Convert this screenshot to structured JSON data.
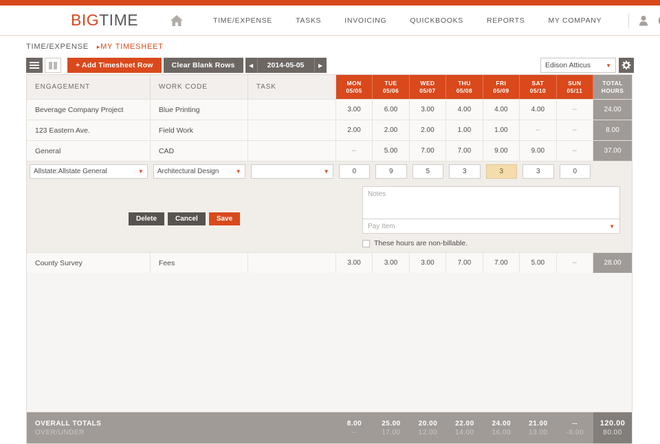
{
  "brand": {
    "name_first": "BIG",
    "name_second": "TIME",
    "accent": "#d9491c",
    "gray": "#6d6763"
  },
  "header": {
    "home_icon": "home-icon",
    "nav": [
      {
        "label": "TIME/EXPENSE"
      },
      {
        "label": "TASKS"
      },
      {
        "label": "INVOICING"
      },
      {
        "label": "QUICKBOOKS"
      },
      {
        "label": "REPORTS"
      },
      {
        "label": "MY COMPANY"
      }
    ],
    "user_icon": "user-icon",
    "help_icon": "help-icon"
  },
  "breadcrumb": {
    "parent": "TIME/EXPENSE",
    "caret": "▸",
    "current": "MY TIMESHEET"
  },
  "toolbar": {
    "view_list_icon": "list-view-icon",
    "view_grid_icon": "grid-view-icon",
    "add_row_label": "+  Add Timesheet Row",
    "clear_rows_label": "Clear Blank Rows",
    "prev_arrow": "◀",
    "next_arrow": "▶",
    "date_value": "2014-05-05",
    "user_name": "Edison Atticus",
    "dropdown_caret": "▼",
    "gear_icon": "gear-icon"
  },
  "grid": {
    "columns": {
      "engagement": "ENGAGEMENT",
      "work_code": "WORK CODE",
      "task": "TASK",
      "total_line1": "TOTAL",
      "total_line2": "HOURS"
    },
    "days": [
      {
        "name": "MON",
        "date": "05/05"
      },
      {
        "name": "TUE",
        "date": "05/06"
      },
      {
        "name": "WED",
        "date": "05/07"
      },
      {
        "name": "THU",
        "date": "05/08"
      },
      {
        "name": "FRI",
        "date": "05/09"
      },
      {
        "name": "SAT",
        "date": "05/10"
      },
      {
        "name": "SUN",
        "date": "05/11"
      }
    ],
    "rows": [
      {
        "engagement": "Beverage Company Project",
        "work_code": "Blue Printing",
        "task": "",
        "hours": [
          "3.00",
          "6.00",
          "3.00",
          "4.00",
          "4.00",
          "4.00",
          "--"
        ],
        "total": "24.00"
      },
      {
        "engagement": "123 Eastern Ave.",
        "work_code": "Field Work",
        "task": "",
        "hours": [
          "2.00",
          "2.00",
          "2.00",
          "1.00",
          "1.00",
          "--",
          "--"
        ],
        "total": "8.00"
      },
      {
        "engagement": "General",
        "work_code": "CAD",
        "task": "",
        "hours": [
          "--",
          "5.00",
          "7.00",
          "7.00",
          "9.00",
          "9.00",
          "--"
        ],
        "total": "37.00"
      }
    ],
    "row_after_edit": {
      "engagement": "County Survey",
      "work_code": "Fees",
      "task": "",
      "hours": [
        "3.00",
        "3.00",
        "3.00",
        "7.00",
        "7.00",
        "5.00",
        "--"
      ],
      "total": "28.00"
    }
  },
  "edit_row": {
    "engagement_value": "Allstate:Allstate General",
    "work_code_value": "Architectural Design",
    "task_value": "",
    "hours": [
      "0",
      "9",
      "5",
      "3",
      "3",
      "3",
      "0"
    ],
    "focused_index": 4,
    "notes_placeholder": "Notes",
    "pay_item_placeholder": "Pay Item",
    "non_billable_label": "These hours are non-billable.",
    "non_billable_checked": false,
    "delete_label": "Delete",
    "cancel_label": "Cancel",
    "save_label": "Save"
  },
  "footer": {
    "totals_label": "OVERALL TOTALS",
    "overunder_label": "OVER/UNDER",
    "totals": [
      "8.00",
      "25.00",
      "20.00",
      "22.00",
      "24.00",
      "21.00",
      "--"
    ],
    "overunder": [
      "--",
      "17.00",
      "12.00",
      "14.00",
      "16.00",
      "13.00",
      "-8.00"
    ],
    "grand_total": "120.00",
    "grand_overunder": "80.00"
  }
}
